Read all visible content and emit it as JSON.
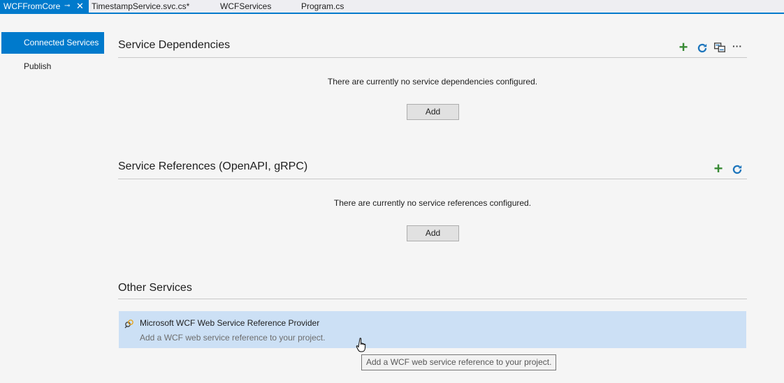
{
  "tabs": [
    {
      "label": "WCFFromCore",
      "active": true
    },
    {
      "label": "TimestampService.svc.cs*"
    },
    {
      "label": "WCFServices"
    },
    {
      "label": "Program.cs"
    }
  ],
  "tab_pin_glyph": "⊸",
  "tab_close_glyph": "✕",
  "nav": {
    "items": [
      {
        "label": "Connected Services",
        "selected": true
      },
      {
        "label": "Publish"
      }
    ]
  },
  "service_dependencies": {
    "title": "Service Dependencies",
    "empty_message": "There are currently no service dependencies configured.",
    "add_label": "Add",
    "more_glyph": "···"
  },
  "service_references": {
    "title": "Service References (OpenAPI, gRPC)",
    "empty_message": "There are currently no service references configured.",
    "add_label": "Add"
  },
  "other_services": {
    "title": "Other Services",
    "provider": {
      "title": "Microsoft WCF Web Service Reference Provider",
      "description": "Add a WCF web service reference to your project."
    }
  },
  "tooltip": "Add a WCF web service reference to your project.",
  "colors": {
    "accent": "#007acc",
    "add_green": "#388a34",
    "refresh_blue": "#1c75bc",
    "selection": "#cce0f5"
  }
}
